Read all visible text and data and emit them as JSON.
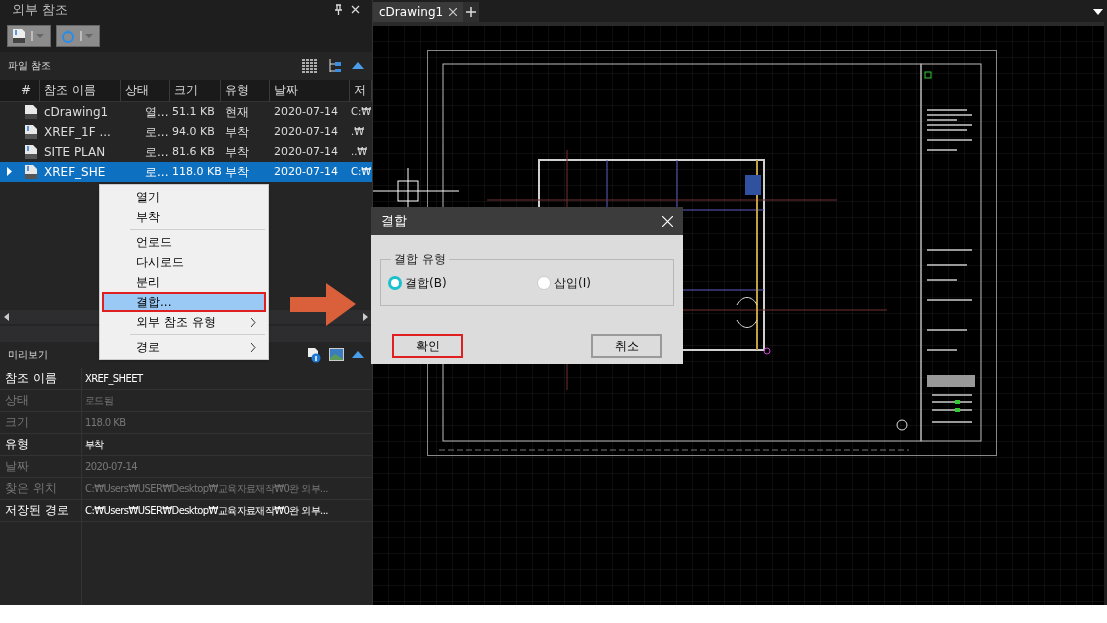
{
  "panel": {
    "title": "외부 참조"
  },
  "file_refs": {
    "title": "파일 참조",
    "columns": [
      "#",
      "참조 이름",
      "상태",
      "크기",
      "유형",
      "날짜",
      "저"
    ],
    "rows": [
      {
        "kind": "doc",
        "name": "cDrawing1",
        "status": "열...",
        "size": "51.1 KB",
        "type": "현재",
        "date": "2020-07-14",
        "path": "C:₩",
        "selected": false
      },
      {
        "kind": "dwg",
        "name": "XREF_1F ...",
        "status": "로...",
        "size": "94.0 KB",
        "type": "부착",
        "date": "2020-07-14",
        "path": ".₩",
        "selected": false
      },
      {
        "kind": "dwg",
        "name": "SITE PLAN",
        "status": "로...",
        "size": "81.6 KB",
        "type": "부착",
        "date": "2020-07-14",
        "path": "..₩",
        "selected": false
      },
      {
        "kind": "dwg",
        "name": "XREF_SHE",
        "status": "로...",
        "size": "118.0 KB",
        "type": "부착",
        "date": "2020-07-14",
        "path": "C:₩",
        "selected": true
      }
    ]
  },
  "context_menu": [
    {
      "kind": "item",
      "label": "열기",
      "submenu": false,
      "highlighted": false
    },
    {
      "kind": "item",
      "label": "부착",
      "submenu": false,
      "highlighted": false
    },
    {
      "kind": "separator"
    },
    {
      "kind": "item",
      "label": "언로드",
      "submenu": false,
      "highlighted": false
    },
    {
      "kind": "item",
      "label": "다시로드",
      "submenu": false,
      "highlighted": false
    },
    {
      "kind": "item",
      "label": "분리",
      "submenu": false,
      "highlighted": false
    },
    {
      "kind": "item",
      "label": "결합...",
      "submenu": false,
      "highlighted": true
    },
    {
      "kind": "item",
      "label": "외부 참조 유형",
      "submenu": true,
      "highlighted": false
    },
    {
      "kind": "separator"
    },
    {
      "kind": "item",
      "label": "경로",
      "submenu": true,
      "highlighted": false
    }
  ],
  "preview": {
    "title": "미리보기",
    "properties": [
      {
        "label": "참조 이름",
        "value": "XREF_SHEET",
        "dimmed": false
      },
      {
        "label": "상태",
        "value": "로드됨",
        "dimmed": true
      },
      {
        "label": "크기",
        "value": "118.0 KB",
        "dimmed": true
      },
      {
        "label": "유형",
        "value": "부착",
        "dimmed": false
      },
      {
        "label": "날짜",
        "value": "2020-07-14",
        "dimmed": true
      },
      {
        "label": "찾은 위치",
        "value": "C:₩Users₩USER₩Desktop₩교육자료재작₩0완 외부...",
        "dimmed": true
      },
      {
        "label": "저장된 경로",
        "value": "C:₩Users₩USER₩Desktop₩교육자료재작₩0완 외부...",
        "dimmed": false
      }
    ]
  },
  "tabs": [
    {
      "label": "cDrawing1",
      "selected": true
    }
  ],
  "dialog": {
    "title": "결합",
    "group_label": "결합 유형",
    "options": [
      {
        "label": "결합(B)",
        "selected": true
      },
      {
        "label": "삽입(I)",
        "selected": false
      }
    ],
    "buttons": [
      {
        "label": "확인",
        "highlighted": true
      },
      {
        "label": "취소",
        "highlighted": false
      }
    ]
  }
}
